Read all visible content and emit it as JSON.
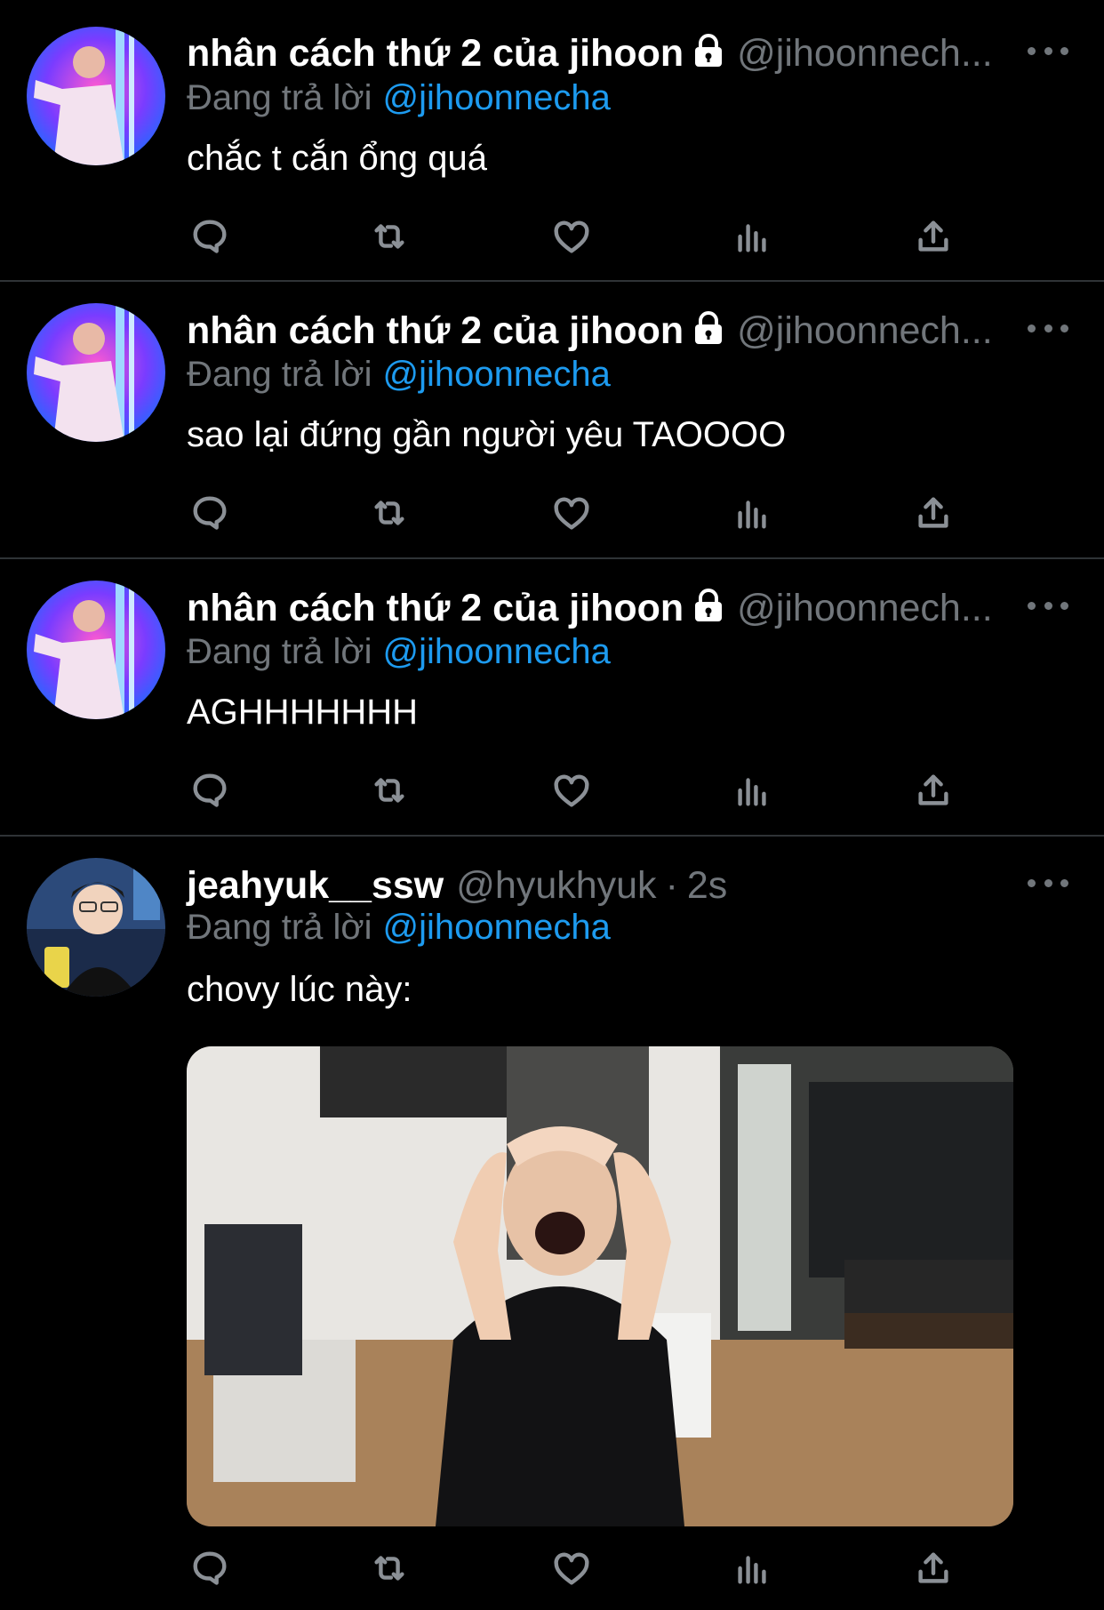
{
  "tweets": [
    {
      "name": "nhân cách thứ 2 của jihoon",
      "handle": "@jihoonnech...",
      "time": "",
      "reply_prefix": "Đang trả lời",
      "reply_to": "@jihoonnecha",
      "text": "chắc t cắn ổng quá",
      "protected": true
    },
    {
      "name": "nhân cách thứ 2 của jihoon",
      "handle": "@jihoonnech...",
      "time": "",
      "reply_prefix": "Đang trả lời",
      "reply_to": "@jihoonnecha",
      "text": "sao lại đứng gần người yêu TAOOOO",
      "protected": true
    },
    {
      "name": "nhân cách thứ 2 của jihoon",
      "handle": "@jihoonnech...",
      "time": "",
      "reply_prefix": "Đang trả lời",
      "reply_to": "@jihoonnecha",
      "text": "AGHHHHHHH",
      "protected": true
    },
    {
      "name": "jeahyuk__ssw",
      "handle": "@hyukhyuk",
      "separator": "·",
      "time": "2s",
      "reply_prefix": "Đang trả lời",
      "reply_to": "@jihoonnecha",
      "text": "chovy lúc này:",
      "protected": false,
      "media": "photo-of-person-holding-head-screaming-in-office"
    }
  ],
  "action_icons": [
    "reply-icon",
    "retweet-icon",
    "like-icon",
    "views-icon",
    "share-icon"
  ],
  "colors": {
    "background": "#000000",
    "text": "#ffffff",
    "muted": "#71767b",
    "link": "#1d9bf0",
    "divider": "#2f3336"
  }
}
